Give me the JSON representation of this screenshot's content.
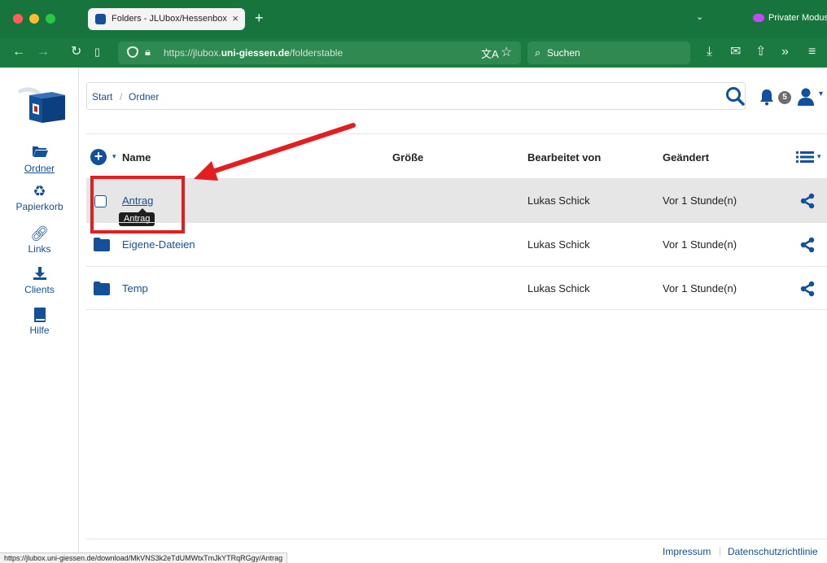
{
  "browser": {
    "tab_title": "Folders - JLUbox/Hessenbox",
    "tab_close": "×",
    "new_tab": "+",
    "tab_list": "⌄",
    "private_mode_label": "Privater Modus",
    "url_prefix": "https://jlubox.",
    "url_domain": "uni-giessen.de",
    "url_path": "/folderstable",
    "search_placeholder": "Suchen",
    "status_url": "https://jlubox.uni-giessen.de/download/MkVNS3k2eTdUMWtxTmJkYTRqRGgy/Antrag"
  },
  "sidebar": {
    "items": [
      {
        "label": "Ordner",
        "icon": "folder-open-icon"
      },
      {
        "label": "Papierkorb",
        "icon": "recycle-icon"
      },
      {
        "label": "Links",
        "icon": "link-icon"
      },
      {
        "label": "Clients",
        "icon": "download-icon"
      },
      {
        "label": "Hilfe",
        "icon": "book-icon"
      }
    ]
  },
  "breadcrumb": {
    "start": "Start",
    "separator": "/",
    "current": "Ordner"
  },
  "header": {
    "notification_count": "5"
  },
  "table": {
    "columns": {
      "name": "Name",
      "size": "Größe",
      "edited_by": "Bearbeitet von",
      "changed": "Geändert"
    },
    "rows": [
      {
        "name": "Antrag",
        "type": "file",
        "edited_by": "Lukas Schick",
        "changed": "Vor 1 Stunde(n)"
      },
      {
        "name": "Eigene-Dateien",
        "type": "folder",
        "edited_by": "Lukas Schick",
        "changed": "Vor 1 Stunde(n)"
      },
      {
        "name": "Temp",
        "type": "folder",
        "edited_by": "Lukas Schick",
        "changed": "Vor 1 Stunde(n)"
      }
    ],
    "tooltip": "Antrag"
  },
  "footer": {
    "impressum": "Impressum",
    "privacy": "Datenschutzrichtlinie"
  },
  "colors": {
    "brand_blue": "#12509b",
    "browser_green": "#17743c",
    "annotation_red": "#e41e1e"
  }
}
